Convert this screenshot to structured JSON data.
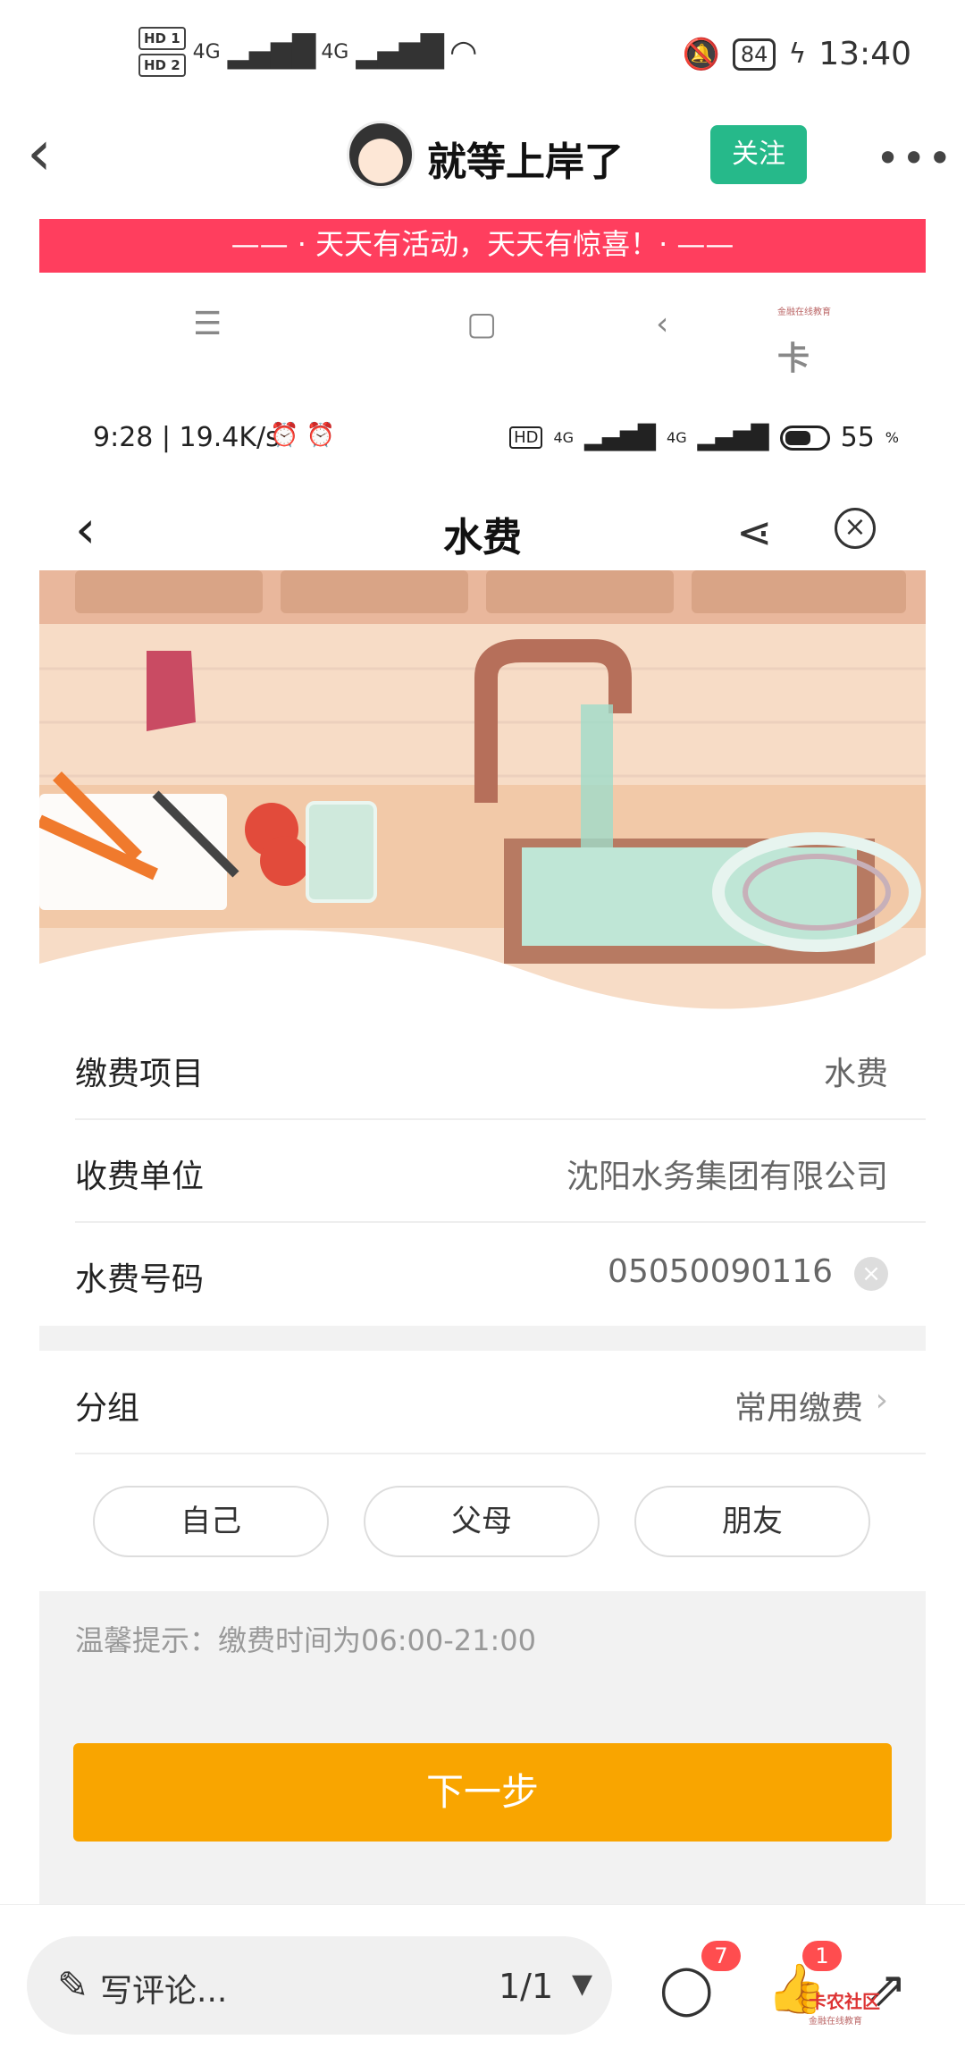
{
  "outer_status": {
    "network1": "HD 1",
    "network2": "HD 2",
    "net_type": "4G",
    "battery": "84",
    "time": "13:40"
  },
  "post_header": {
    "username": "就等上岸了",
    "follow_label": "关注"
  },
  "banner_text": "—— · 天天有活动，天天有惊喜！· ——",
  "watermark": {
    "name": "卡农社区",
    "sub": "金融在线教育"
  },
  "inner_status": {
    "left": "9:28 | 19.4K/s",
    "battery": "55",
    "net": "4G"
  },
  "page": {
    "title": "水费"
  },
  "form": {
    "rows": [
      {
        "label": "缴费项目",
        "value": "水费"
      },
      {
        "label": "收费单位",
        "value": "沈阳水务集团有限公司"
      },
      {
        "label": "水费号码",
        "value": "05050090116"
      }
    ],
    "group_label": "分组",
    "group_value": "常用缴费",
    "chips": [
      "自己",
      "父母",
      "朋友"
    ]
  },
  "tip": "温馨提示：缴费时间为06:00-21:00",
  "next_label": "下一步",
  "bottom": {
    "comment_placeholder": "写评论...",
    "page_indicator": "1/1",
    "comment_count": "7",
    "like_count": "1"
  }
}
